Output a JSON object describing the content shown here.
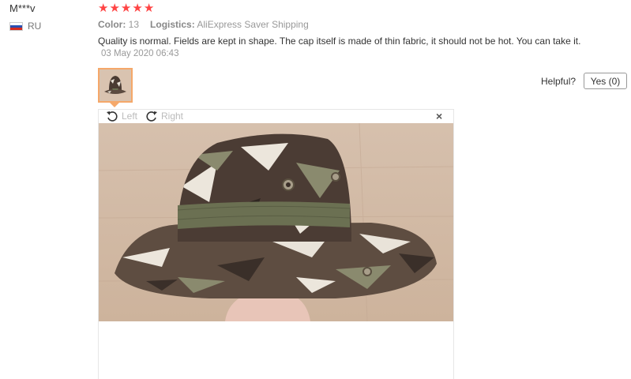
{
  "reviewer": {
    "name": "M***v",
    "country": "RU"
  },
  "rating": {
    "stars": 5,
    "star_glyph": "★"
  },
  "meta": {
    "color_label": "Color:",
    "color_value": "13",
    "logistics_label": "Logistics:",
    "logistics_value": "AliExpress Saver Shipping"
  },
  "review": {
    "text": "Quality is normal. Fields are kept in shape. The cap itself is made of thin fabric, it should not be hot. You can take it.",
    "date": "03 May 2020 06:43"
  },
  "feedback": {
    "helpful_label": "Helpful?",
    "yes_button": "Yes (0)"
  },
  "viewer": {
    "rotate_left": "Left",
    "rotate_right": "Right",
    "close": "×"
  },
  "colors": {
    "star": "#ff4444",
    "thumb_border": "#f5a86a",
    "muted": "#999999"
  }
}
